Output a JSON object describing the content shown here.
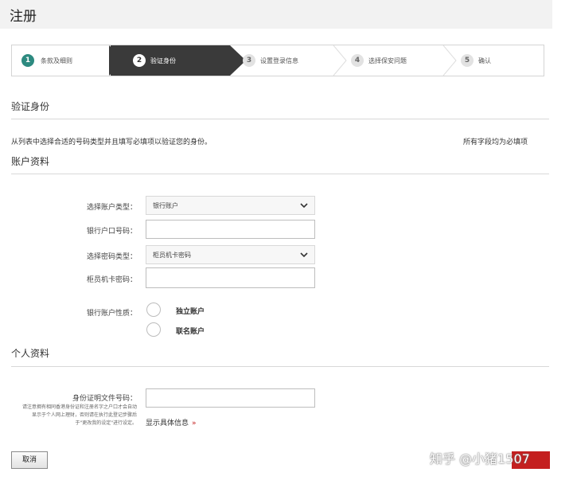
{
  "header": {
    "title": "注册"
  },
  "steps": [
    {
      "num": "1",
      "label": "条款及细则",
      "state": "done"
    },
    {
      "num": "2",
      "label": "验证身份",
      "state": "active"
    },
    {
      "num": "3",
      "label": "设置登录信息",
      "state": "pending"
    },
    {
      "num": "4",
      "label": "选择保安问题",
      "state": "pending"
    },
    {
      "num": "5",
      "label": "确认",
      "state": "pending"
    }
  ],
  "verify": {
    "title": "验证身份",
    "intro": "从列表中选择合适的号码类型并且填写必填项以验证您的身份。",
    "required_note": "所有字段均为必填项"
  },
  "account": {
    "title": "账户资料",
    "account_type_label": "选择账户类型：",
    "account_type_value": "银行账户",
    "account_number_label": "银行户口号码：",
    "account_number_value": "",
    "password_type_label": "选择密码类型：",
    "password_type_value": "柜员机卡密码",
    "atm_pin_label": "柜员机卡密码：",
    "atm_pin_value": "",
    "nature_label": "银行账户性质：",
    "nature_options": [
      "独立账户",
      "联名账户"
    ]
  },
  "personal": {
    "title": "个人资料",
    "id_label": "身份证明文件号码：",
    "id_value": "",
    "hint": "请注意拥有相同香港身份证和注册名字之户口才会自动显示于个人网上理财，否则请在执行此登记步骤后于\"更改我的设定\"进行设定。",
    "show_more": "显示具体信息",
    "show_more_icon": "»"
  },
  "buttons": {
    "cancel": "取消"
  },
  "watermark": "知乎 @小猪1507",
  "colors": {
    "accent_red": "#c41f1f",
    "step_done": "#2d8a80",
    "step_active": "#3a3a3a"
  }
}
